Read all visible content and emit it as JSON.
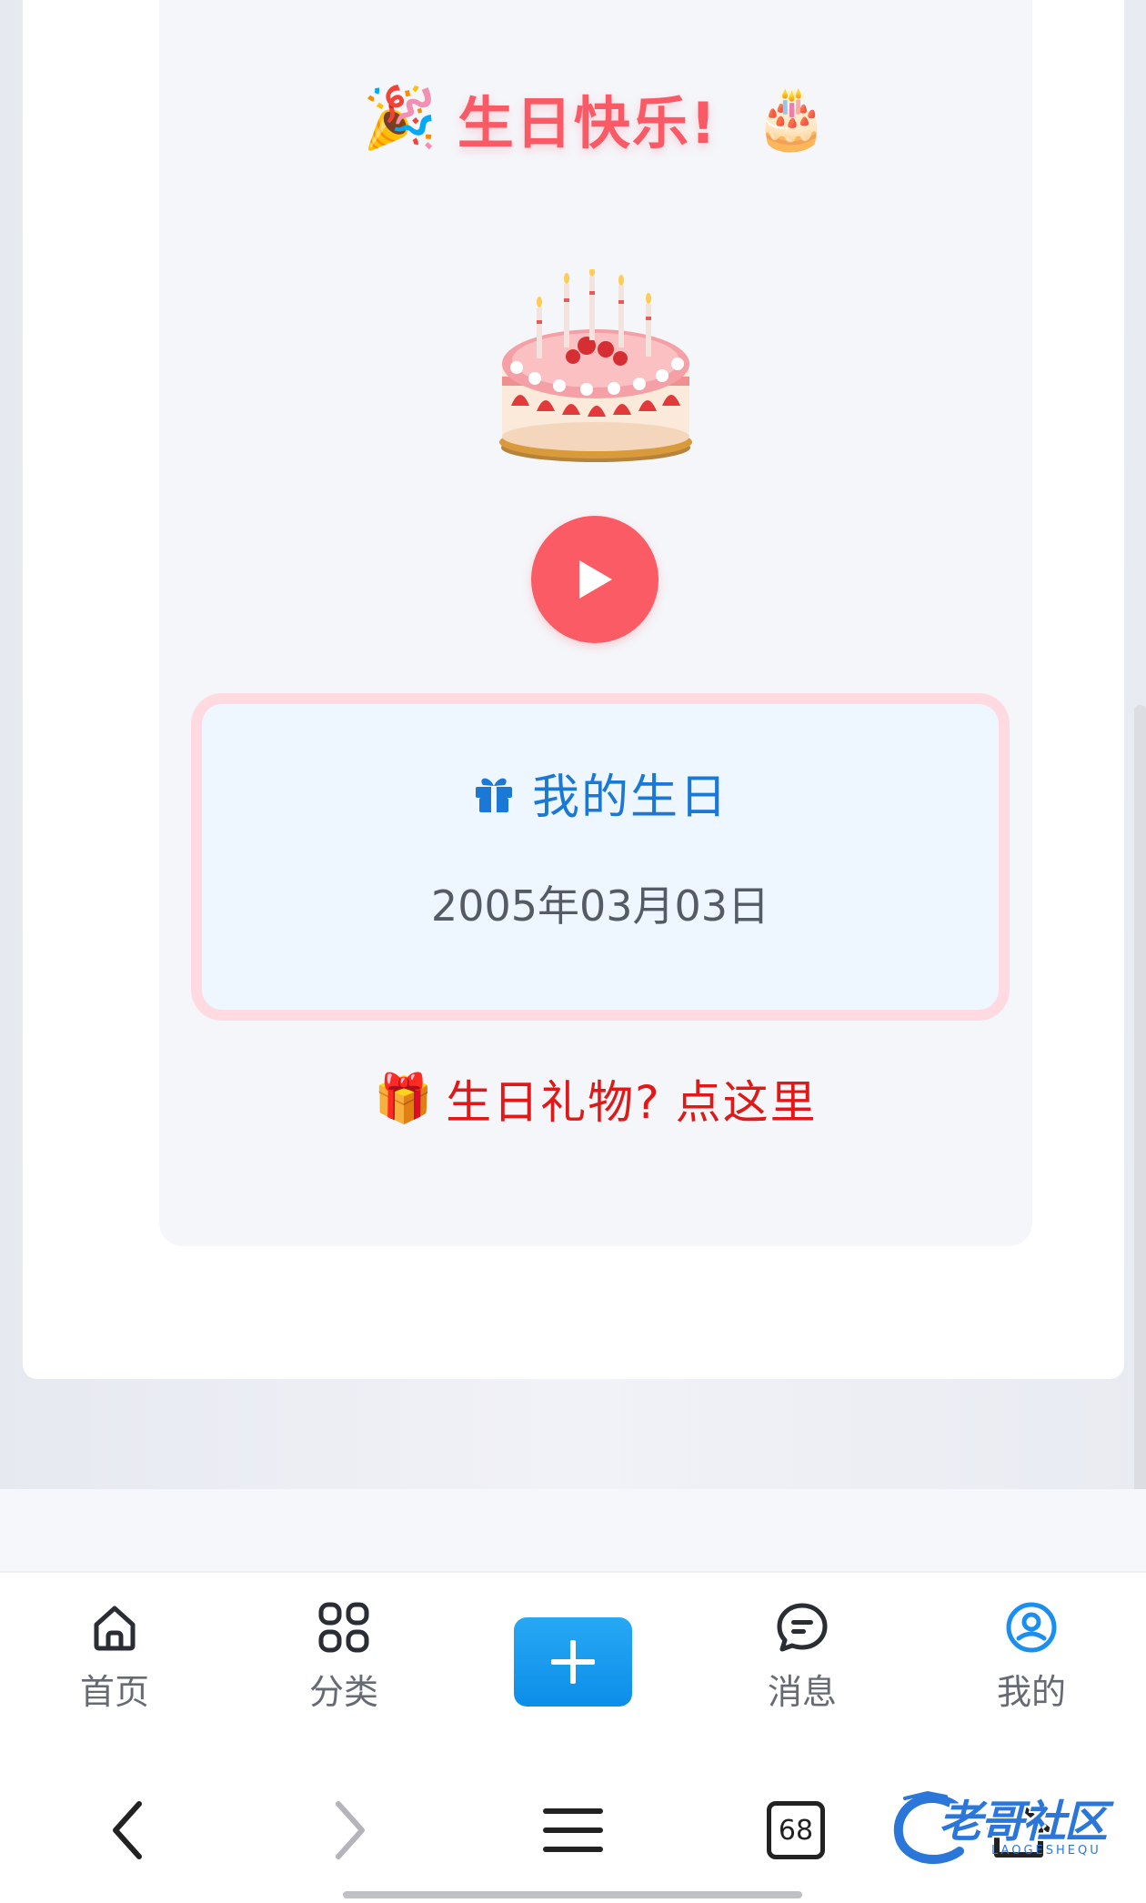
{
  "greeting": {
    "title": "生日快乐!",
    "left_emoji": "🎉",
    "right_emoji": "🎂"
  },
  "media": {
    "cake_icon": "birthday-cake-image",
    "play_icon": "play-icon"
  },
  "birthday_card": {
    "icon": "🎁",
    "title": "我的生日",
    "date": "2005年03月03日"
  },
  "gift_link": {
    "icon": "🎁",
    "question": "生日礼物?",
    "action": "点这里"
  },
  "tab_bar": {
    "items": [
      {
        "label": "首页",
        "icon": "home-icon"
      },
      {
        "label": "分类",
        "icon": "grid-icon"
      },
      {
        "label": "",
        "icon": "plus-icon"
      },
      {
        "label": "消息",
        "icon": "chat-icon"
      },
      {
        "label": "我的",
        "icon": "user-icon"
      }
    ],
    "active_color": "#1a8ff0",
    "inactive_color": "#555a63"
  },
  "system_nav": {
    "tab_count": "68"
  },
  "watermark": {
    "text": "老哥社区",
    "sub": "LAOGESHEQU"
  },
  "colors": {
    "accent_red": "#fa5a66",
    "link_red": "#e01818",
    "title_blue": "#1b78d4",
    "card_border": "#ffdbe1",
    "card_bg": "#eef7ff"
  }
}
